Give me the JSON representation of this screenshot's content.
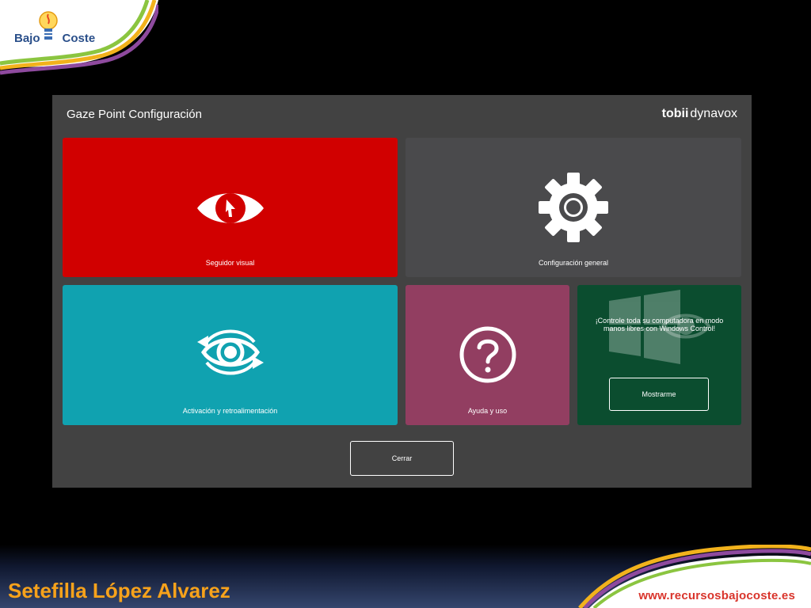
{
  "logo": {
    "word_1": "Bajo",
    "word_2": "Coste"
  },
  "dialog": {
    "title": "Gaze Point Configuración",
    "brand_bold": "tobii",
    "brand_light": "dynavox",
    "tiles": {
      "eye_tracker": {
        "label": "Seguidor visual",
        "icon": "eye-cursor-icon"
      },
      "general": {
        "label": "Configuración general",
        "icon": "gear-icon"
      },
      "activation": {
        "label": "Activación y retroalimentación",
        "icon": "eye-refresh-icon"
      },
      "help": {
        "label": "Ayuda y uso",
        "icon": "question-icon"
      },
      "windows": {
        "promo": "¡Controle toda su computadora en modo manos libres con Windows Control!",
        "button": "Mostrarme",
        "icon": "windows-logo-icon"
      }
    },
    "close_button": "Cerrar"
  },
  "footer": {
    "author": "Setefilla López Alvarez",
    "website": "www.recursosbajocoste.es"
  },
  "colors": {
    "eye_tracker": "#d10000",
    "general": "#4a4a4c",
    "activation": "#10a2b0",
    "help": "#923e61",
    "windows": "#0b4d2f",
    "dialog": "#424242",
    "author": "#f7a21b",
    "website": "#d9342b"
  }
}
